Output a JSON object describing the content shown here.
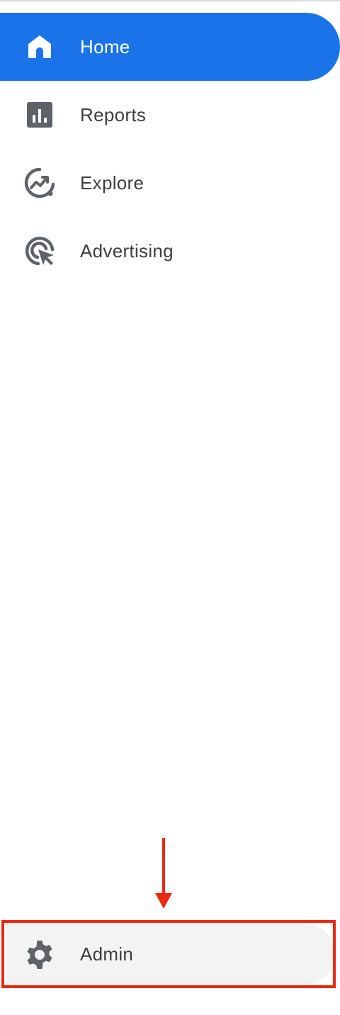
{
  "nav": {
    "items": [
      {
        "label": "Home",
        "icon": "home-icon",
        "active": true
      },
      {
        "label": "Reports",
        "icon": "reports-bar-chart-icon",
        "active": false
      },
      {
        "label": "Explore",
        "icon": "explore-trend-icon",
        "active": false
      },
      {
        "label": "Advertising",
        "icon": "advertising-cursor-icon",
        "active": false
      }
    ]
  },
  "footer": {
    "admin_label": "Admin",
    "admin_icon": "gear-icon"
  },
  "colors": {
    "active_bg": "#1a73e8",
    "icon": "#5f6368",
    "text": "#3c4043",
    "annotation": "#ea2a10",
    "hover_bg": "#f3f3f3"
  }
}
